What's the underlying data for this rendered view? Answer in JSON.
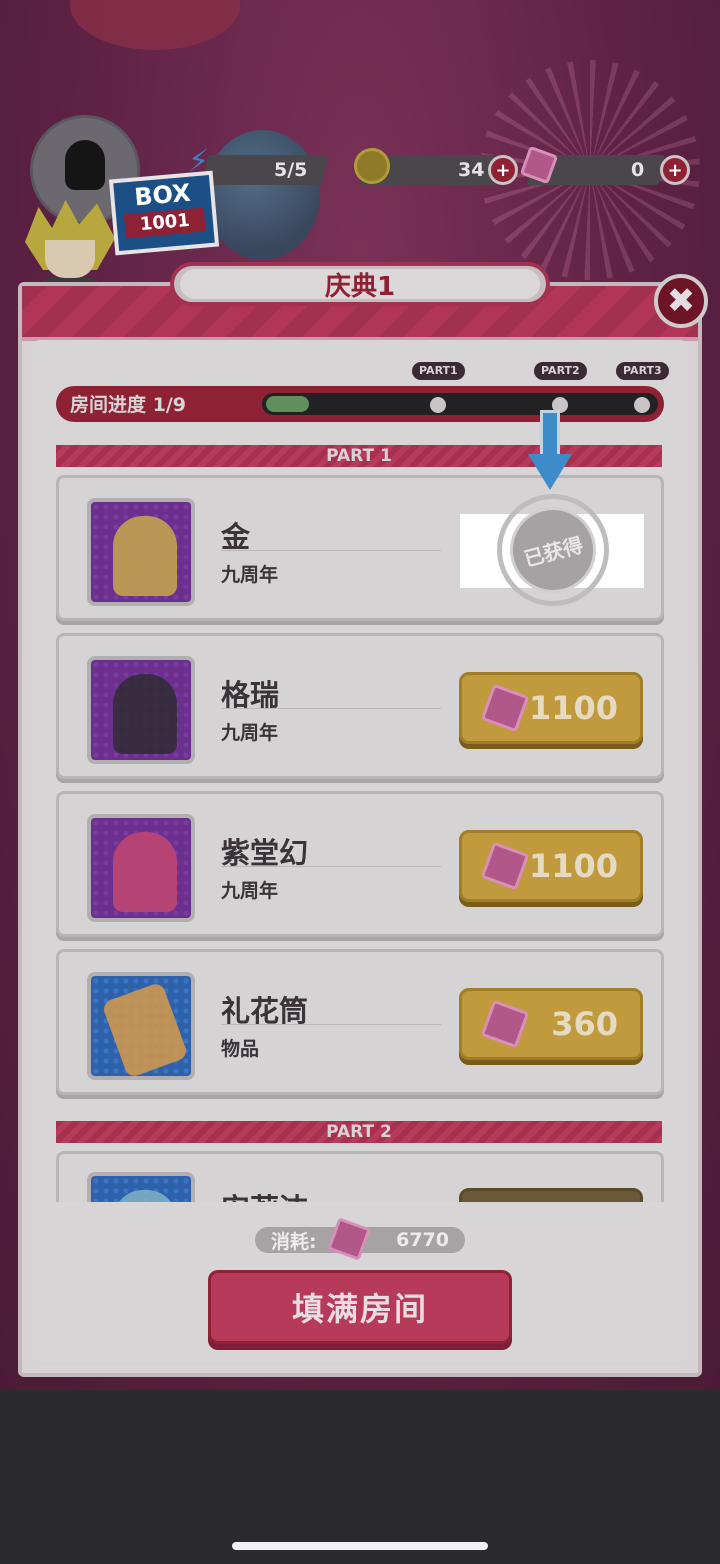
{
  "hud": {
    "energy": "5/5",
    "coins": "34",
    "gems": "0",
    "plus": "+"
  },
  "logo": {
    "line1": "BOX",
    "line2": "1001"
  },
  "panel": {
    "title": "庆典1",
    "close_symbol": "✖"
  },
  "progress": {
    "label": "房间进度 1/9",
    "value": 0.11,
    "markers": [
      "PART1",
      "PART2",
      "PART3"
    ]
  },
  "sections": [
    {
      "header": "PART 1"
    },
    {
      "header": "PART 2"
    }
  ],
  "items": [
    {
      "name": "金",
      "sub": "九周年",
      "status": "已获得",
      "owned": true,
      "icon": "character-portrait-icon"
    },
    {
      "name": "格瑞",
      "sub": "九周年",
      "price": "1100",
      "owned": false,
      "icon": "character-portrait-icon"
    },
    {
      "name": "紫堂幻",
      "sub": "九周年",
      "price": "1100",
      "owned": false,
      "icon": "character-portrait-icon"
    },
    {
      "name": "礼花筒",
      "sub": "物品",
      "price": "360",
      "owned": false,
      "icon": "party-popper-icon"
    },
    {
      "name": "安莉洁",
      "sub": "",
      "price": "",
      "owned": false,
      "icon": "character-portrait-icon"
    }
  ],
  "footer": {
    "cost_label": "消耗:",
    "cost_value": "6770",
    "fill_button": "填满房间"
  },
  "colors": {
    "accent": "#b73a5a",
    "gold_button": "#c09a3c",
    "gem": "#b2578a",
    "progress_fill": "#5f8f5a"
  }
}
